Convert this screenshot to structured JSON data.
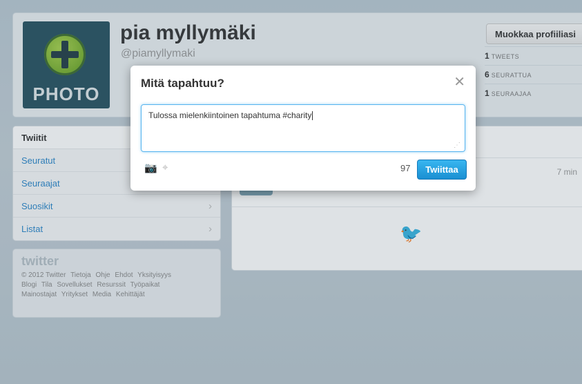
{
  "profile": {
    "name": "pia myllymäki",
    "handle": "@piamyllymaki",
    "photo_text": "PHOTO",
    "edit_button": "Muokkaa profiiliasi",
    "stats": [
      {
        "count": "1",
        "label": "TWEETS"
      },
      {
        "count": "6",
        "label": "SEURATTUA"
      },
      {
        "count": "1",
        "label": "SEURAAJAA"
      }
    ]
  },
  "sidebar": {
    "items": [
      {
        "label": "Twiitit"
      },
      {
        "label": "Seuratut"
      },
      {
        "label": "Seuraajat"
      },
      {
        "label": "Suosikit"
      },
      {
        "label": "Listat"
      }
    ]
  },
  "footer": {
    "logo": "twitter",
    "line1": [
      "© 2012 Twitter",
      "Tietoja",
      "Ohje",
      "Ehdot",
      "Yksityisyys"
    ],
    "line2": [
      "Blogi",
      "Tila",
      "Sovellukset",
      "Resurssit",
      "Työpaikat"
    ],
    "line3": [
      "Mainostajat",
      "Yritykset",
      "Media",
      "Kehittäjät"
    ]
  },
  "timeline": {
    "time": "7 min"
  },
  "modal": {
    "title": "Mitä tapahtuu?",
    "close": "✕",
    "text": "Tulossa mielenkiintoinen tapahtuma #charity",
    "char_count": "97",
    "tweet_button": "Twiittaa",
    "camera_icon": "📷",
    "location_icon": "⌖"
  }
}
